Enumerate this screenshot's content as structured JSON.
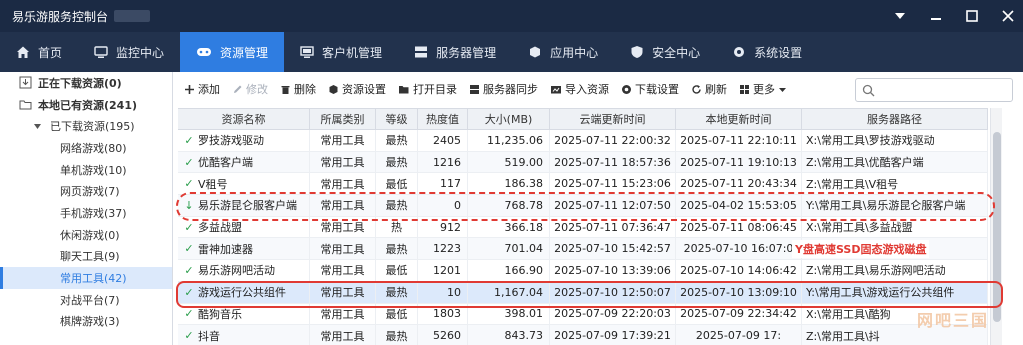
{
  "window": {
    "title": "易乐游服务控制台"
  },
  "nav": {
    "items": [
      {
        "label": "首页",
        "icon": "home-icon"
      },
      {
        "label": "监控中心",
        "icon": "monitor-icon"
      },
      {
        "label": "资源管理",
        "icon": "gamepad-icon",
        "active": true
      },
      {
        "label": "客户机管理",
        "icon": "client-icon"
      },
      {
        "label": "服务器管理",
        "icon": "server-icon"
      },
      {
        "label": "应用中心",
        "icon": "app-icon"
      },
      {
        "label": "安全中心",
        "icon": "shield-icon"
      },
      {
        "label": "系统设置",
        "icon": "gear-icon"
      }
    ]
  },
  "sidebar": {
    "items": [
      {
        "label": "正在下载资源(0)",
        "level": 0,
        "bold": true,
        "icon": "download-icon"
      },
      {
        "label": "本地已有资源(241)",
        "level": 0,
        "bold": true,
        "icon": "folder-icon"
      },
      {
        "label": "已下载资源(195)",
        "level": 1,
        "icon": "caret-down-icon"
      },
      {
        "label": "网络游戏(80)",
        "level": 2
      },
      {
        "label": "单机游戏(10)",
        "level": 2
      },
      {
        "label": "网页游戏(7)",
        "level": 2
      },
      {
        "label": "手机游戏(37)",
        "level": 2
      },
      {
        "label": "休闲游戏(0)",
        "level": 2
      },
      {
        "label": "聊天工具(9)",
        "level": 2
      },
      {
        "label": "常用工具(42)",
        "level": 2,
        "active": true
      },
      {
        "label": "对战平台(7)",
        "level": 2
      },
      {
        "label": "棋牌游戏(3)",
        "level": 2
      }
    ]
  },
  "toolbar": {
    "buttons": [
      {
        "label": "添加",
        "icon": "plus-icon"
      },
      {
        "label": "修改",
        "icon": "edit-icon",
        "disabled": true
      },
      {
        "label": "删除",
        "icon": "trash-icon"
      },
      {
        "label": "资源设置",
        "icon": "box-icon"
      },
      {
        "label": "打开目录",
        "icon": "folder-open-icon"
      },
      {
        "label": "服务器同步",
        "icon": "server-sync-icon"
      },
      {
        "label": "导入资源",
        "icon": "import-icon"
      },
      {
        "label": "下载设置",
        "icon": "gear-icon"
      },
      {
        "label": "刷新",
        "icon": "refresh-icon"
      },
      {
        "label": "更多",
        "icon": "grid-icon"
      }
    ],
    "search_placeholder": ""
  },
  "table": {
    "headers": [
      "资源名称",
      "所属类别",
      "等级",
      "热度值",
      "大小(MB)",
      "云端更新时间",
      "本地更新时间",
      "服务器路径"
    ],
    "rows": [
      {
        "status": "✓",
        "name": "罗技游戏驱动",
        "category": "常用工具",
        "level": "最热",
        "heat": "2405",
        "size": "11,235.06",
        "cloud": "2025-07-11 22:00:32",
        "local": "2025-07-11 22:10:11",
        "path": "X:\\常用工具\\罗技游戏驱动"
      },
      {
        "status": "✓",
        "name": "优酷客户端",
        "category": "常用工具",
        "level": "最热",
        "heat": "1216",
        "size": "519.00",
        "cloud": "2025-07-11 18:57:36",
        "local": "2025-07-11 19:10:13",
        "path": "Z:\\常用工具\\优酷客户端"
      },
      {
        "status": "✓",
        "name": "V租号",
        "category": "常用工具",
        "level": "最低",
        "heat": "117",
        "size": "186.38",
        "cloud": "2025-07-11 15:23:06",
        "local": "2025-07-11 20:43:34",
        "path": "Z:\\常用工具\\V租号"
      },
      {
        "status": "↓",
        "name": "易乐游昆仑服客户端",
        "category": "常用工具",
        "level": "最热",
        "heat": "0",
        "size": "768.78",
        "cloud": "2025-07-11 12:07:50",
        "local": "2025-04-02 15:53:05",
        "path": "Y:\\常用工具\\易乐游昆仑服客户端"
      },
      {
        "status": "✓",
        "name": "多益战盟",
        "category": "常用工具",
        "level": "热",
        "heat": "912",
        "size": "366.18",
        "cloud": "2025-07-11 07:36:47",
        "local": "2025-07-11 08:06:45",
        "path": "X:\\常用工具\\多益战盟"
      },
      {
        "status": "✓",
        "name": "雷神加速器",
        "category": "常用工具",
        "level": "最热",
        "heat": "1223",
        "size": "701.04",
        "cloud": "2025-07-10 15:42:57",
        "local": "2025-07-10 16:07:0",
        "path": "器"
      },
      {
        "status": "✓",
        "name": "易乐游网吧活动",
        "category": "常用工具",
        "level": "最低",
        "heat": "1201",
        "size": "166.90",
        "cloud": "2025-07-10 13:39:06",
        "local": "2025-07-10 14:06:42",
        "path": "Z:\\常用工具\\易乐游网吧活动"
      },
      {
        "status": "✓",
        "name": "游戏运行公共组件",
        "category": "常用工具",
        "level": "最热",
        "heat": "10",
        "size": "1,167.04",
        "cloud": "2025-07-10 12:50:07",
        "local": "2025-07-10 13:09:10",
        "path": "Y:\\常用工具\\游戏运行公共组件",
        "selected": true
      },
      {
        "status": "✓",
        "name": "酷狗音乐",
        "category": "常用工具",
        "level": "最低",
        "heat": "1803",
        "size": "398.01",
        "cloud": "2025-07-09 22:20:03",
        "local": "2025-07-09 22:34:42",
        "path": "X:\\常用工具\\酷狗"
      },
      {
        "status": "✓",
        "name": "抖音",
        "category": "常用工具",
        "level": "最热",
        "heat": "5260",
        "size": "843.73",
        "cloud": "2025-07-09 17:39:21",
        "local": "2025-07-09 17:",
        "path": "Z:\\常用工具\\抖"
      }
    ]
  },
  "overlay": {
    "label": "Y盘高速SSD固态游戏磁盘",
    "watermark": "网吧三国"
  },
  "colors": {
    "title_bg": "#1b2a44",
    "nav_bg": "#22324d",
    "accent": "#2f7de1",
    "annotation": "#e03a33",
    "ok_green": "#2a9d4b"
  }
}
